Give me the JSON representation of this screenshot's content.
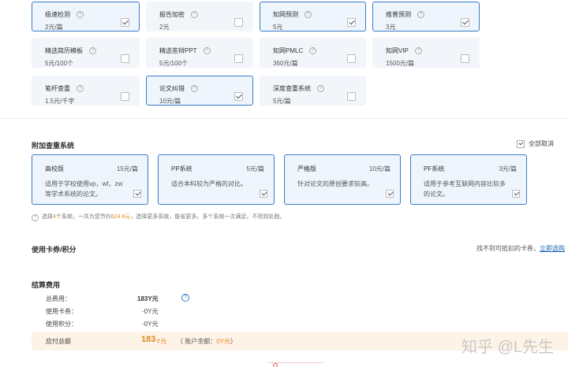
{
  "services": [
    {
      "name": "极速检测",
      "price": "2元/篇",
      "selected": true
    },
    {
      "name": "报告加密",
      "price": "2元",
      "selected": false
    },
    {
      "name": "知网预测",
      "price": "5元",
      "selected": true
    },
    {
      "name": "维普预测",
      "price": "3元",
      "selected": true
    },
    {
      "name": "精选简历模板",
      "price": "5元/100个",
      "selected": false
    },
    {
      "name": "精选答辩PPT",
      "price": "5元/100个",
      "selected": false
    },
    {
      "name": "知网PMLC",
      "price": "360元/篇",
      "selected": false
    },
    {
      "name": "知网VIP",
      "price": "1500元/篇",
      "selected": false
    },
    {
      "name": "笔杆查重",
      "price": "1.5元/千字",
      "selected": false
    },
    {
      "name": "论文纠错",
      "price": "10元/篇",
      "selected": true
    },
    {
      "name": "深度查重系统",
      "price": "5元/篇",
      "selected": false
    }
  ],
  "extra": {
    "title": "附加查重系统",
    "cancel_all": "全部取消",
    "systems": [
      {
        "name": "高校版",
        "price": "15元/篇",
        "desc": "适用于学校使用vp，wf，zw等学术系统的论文。"
      },
      {
        "name": "PP系统",
        "price": "5元/篇",
        "desc": "适合本科较为严格的对比。"
      },
      {
        "name": "严格版",
        "price": "10元/篇",
        "desc": "针对论文的原创要求较高。"
      },
      {
        "name": "PF系统",
        "price": "3元/篇",
        "desc": "适用于参考互联网内容比较多的论文。"
      }
    ],
    "note_prefix": "选择",
    "note_count": "4",
    "note_mid": "个系统，一共为您节约",
    "note_amount": "624.8元",
    "note_suffix": "，选择更多系统，能省更多。多个系统一次满足，不用到处跑。"
  },
  "coupon": {
    "title": "使用卡券/积分",
    "hint": "找不到可抵扣的卡券，",
    "link": "立即选购"
  },
  "settle": {
    "title": "结算费用",
    "total_label": "总费用：",
    "total_value": "183Y元",
    "coupon_label": "使用卡券：",
    "coupon_value": "-0Y元",
    "points_label": "使用积分：",
    "points_value": "-0Y元",
    "due_label": "应付总额",
    "due_amount": "183",
    "due_unit": "Y元",
    "balance_prefix": "（ 账户余额：",
    "balance_value": "0Y元",
    "balance_suffix": "）"
  },
  "watermark": "知乎 @L先生",
  "colors": {
    "accent": "#3a7bc8",
    "highlight": "#e08a1e",
    "link": "#1a5fb4"
  }
}
